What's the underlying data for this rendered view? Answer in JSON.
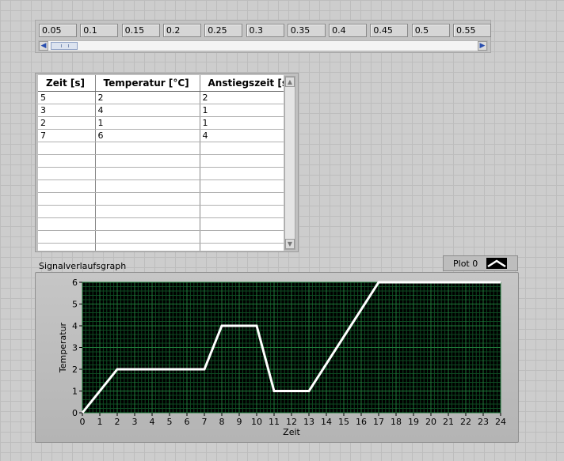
{
  "array": {
    "values": [
      "0.05",
      "0.1",
      "0.15",
      "0.2",
      "0.25",
      "0.3",
      "0.35",
      "0.4",
      "0.45",
      "0.5",
      "0.55"
    ],
    "scroll_left_icon": "arrow-left-icon",
    "scroll_right_icon": "arrow-right-icon"
  },
  "table": {
    "headers": [
      "Zeit [s]",
      "Temperatur [°C]",
      "Anstiegszeit [s]"
    ],
    "rows": [
      [
        "5",
        "2",
        "2"
      ],
      [
        "3",
        "4",
        "1"
      ],
      [
        "2",
        "1",
        "1"
      ],
      [
        "7",
        "6",
        "4"
      ]
    ],
    "empty_rows": 9
  },
  "graph": {
    "label": "Signalverlaufsgraph",
    "legend": {
      "plot_name": "Plot 0"
    }
  },
  "colors": {
    "plot_background": "#000000",
    "grid_major": "#1f7a3a",
    "grid_minor": "#0e4a22",
    "trace": "#ffffff"
  },
  "chart_data": {
    "type": "line",
    "title": "",
    "xlabel": "Zeit",
    "ylabel": "Temperatur",
    "xlim": [
      0,
      24
    ],
    "ylim": [
      0,
      6
    ],
    "xticks": [
      0,
      1,
      2,
      3,
      4,
      5,
      6,
      7,
      8,
      9,
      10,
      11,
      12,
      13,
      14,
      15,
      16,
      17,
      18,
      19,
      20,
      21,
      22,
      23,
      24
    ],
    "yticks": [
      0,
      1,
      2,
      3,
      4,
      5,
      6
    ],
    "grid": true,
    "series": [
      {
        "name": "Plot 0",
        "x": [
          0,
          2,
          7,
          8,
          10,
          11,
          13,
          17,
          24
        ],
        "y": [
          0,
          2,
          2,
          4,
          4,
          1,
          1,
          6,
          6
        ]
      }
    ]
  }
}
